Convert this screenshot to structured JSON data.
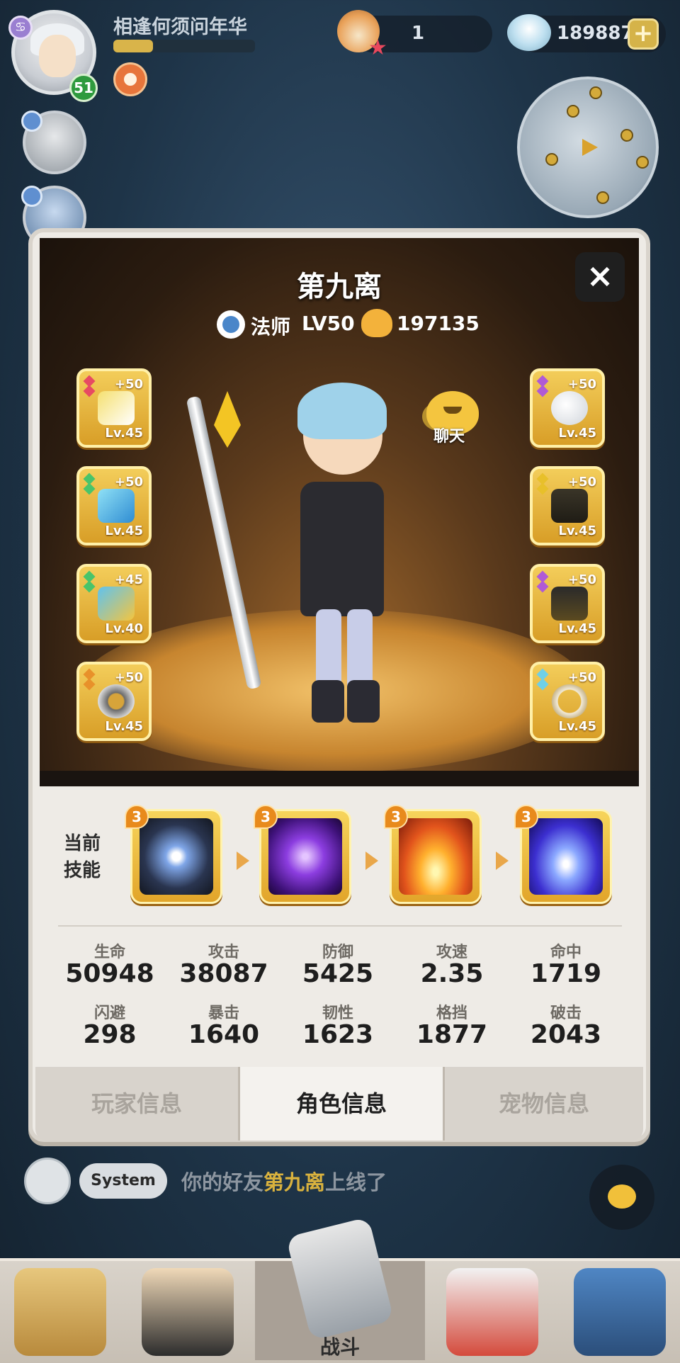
{
  "hud": {
    "player_name": "相逢何须问年华",
    "player_level": "51",
    "exp_progress": 0.28,
    "currency1_value": "1",
    "currency2_value": "189887",
    "plus_label": "+"
  },
  "character": {
    "name": "第九离",
    "class": "法师",
    "level": "LV50",
    "power": "197135",
    "close_label": "×",
    "chat_label": "聊天"
  },
  "equipment": {
    "left": [
      {
        "plus": "+50",
        "level": "Lv.45",
        "icon": "staff-weapon-icon"
      },
      {
        "plus": "+50",
        "level": "Lv.45",
        "icon": "crystal-bracer-icon"
      },
      {
        "plus": "+45",
        "level": "Lv.40",
        "icon": "boot-icon"
      },
      {
        "plus": "+50",
        "level": "Lv.45",
        "icon": "ring-icon"
      }
    ],
    "right": [
      {
        "plus": "+50",
        "level": "Lv.45",
        "icon": "pearl-icon"
      },
      {
        "plus": "+50",
        "level": "Lv.45",
        "icon": "cloak-icon"
      },
      {
        "plus": "+50",
        "level": "Lv.45",
        "icon": "gauntlet-icon"
      },
      {
        "plus": "+50",
        "level": "Lv.45",
        "icon": "necklace-icon"
      }
    ]
  },
  "skills": {
    "label": "当前技能",
    "items": [
      {
        "level": "3",
        "icon": "star-seal-skill-icon"
      },
      {
        "level": "3",
        "icon": "purple-lightning-skill-icon"
      },
      {
        "level": "3",
        "icon": "fire-burst-skill-icon"
      },
      {
        "level": "3",
        "icon": "ice-beam-skill-icon"
      }
    ]
  },
  "stats": [
    {
      "label": "生命",
      "value": "50948"
    },
    {
      "label": "攻击",
      "value": "38087"
    },
    {
      "label": "防御",
      "value": "5425"
    },
    {
      "label": "攻速",
      "value": "2.35"
    },
    {
      "label": "命中",
      "value": "1719"
    },
    {
      "label": "闪避",
      "value": "298"
    },
    {
      "label": "暴击",
      "value": "1640"
    },
    {
      "label": "韧性",
      "value": "1623"
    },
    {
      "label": "格挡",
      "value": "1877"
    },
    {
      "label": "破击",
      "value": "2043"
    }
  ],
  "tabs": [
    {
      "label": "玩家信息",
      "active": false
    },
    {
      "label": "角色信息",
      "active": true
    },
    {
      "label": "宠物信息",
      "active": false
    }
  ],
  "chat": {
    "badge": "System",
    "msg_prefix": "你的好友",
    "msg_name": "第九离",
    "msg_suffix": "上线了"
  },
  "nav": {
    "center_label": "战斗"
  },
  "colors": {
    "gold": "#e2a52a",
    "highlight": "#d9b23e",
    "panel_bg": "#eeebe6"
  }
}
